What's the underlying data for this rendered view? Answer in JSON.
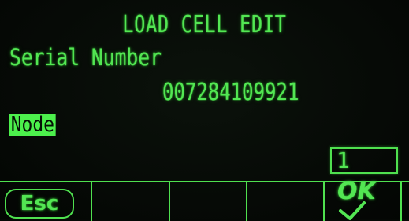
{
  "screen": {
    "title": "LOAD CELL EDIT",
    "serial_label": "Serial Number",
    "serial_value": "007284109921",
    "node_label": "Node",
    "node_value": "1"
  },
  "softkeys": {
    "esc_label": "Esc",
    "ok_label": "OK"
  },
  "colors": {
    "display_green": "#53e653",
    "highlight_green": "#4cf04c",
    "background": "#050805"
  }
}
